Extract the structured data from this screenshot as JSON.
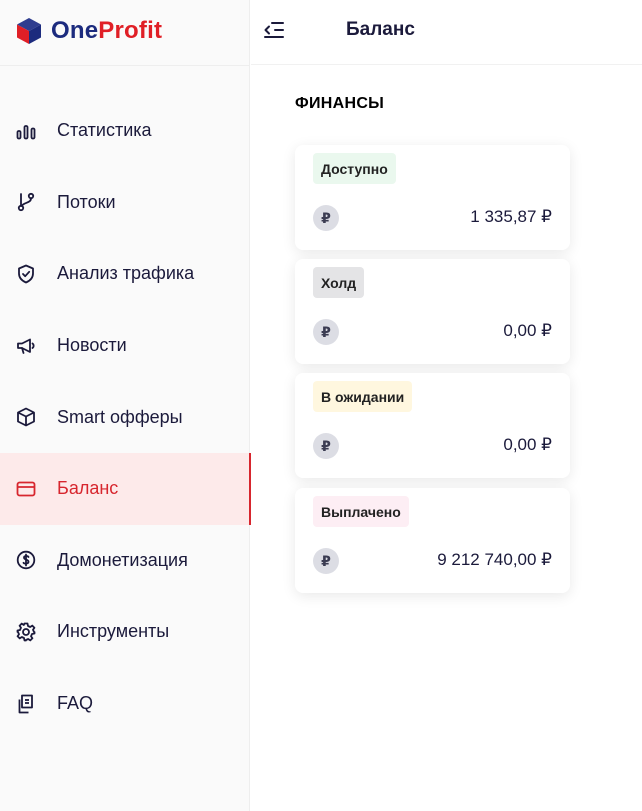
{
  "brand": {
    "part1": "One",
    "part2": "Profit",
    "colors": {
      "primary": "#1c2b7e",
      "accent": "#e01f26"
    }
  },
  "header": {
    "title": "Баланс",
    "collapse_icon": "collapse-sidebar-icon"
  },
  "sidebar": {
    "items": [
      {
        "label": "Статистика",
        "icon": "bar-chart-icon"
      },
      {
        "label": "Потоки",
        "icon": "git-branch-icon"
      },
      {
        "label": "Анализ трафика",
        "icon": "shield-check-icon"
      },
      {
        "label": "Новости",
        "icon": "megaphone-icon"
      },
      {
        "label": "Smart офферы",
        "icon": "cube-icon"
      },
      {
        "label": "Баланс",
        "icon": "card-icon",
        "active": true
      },
      {
        "label": "Домонетизация",
        "icon": "dollar-icon"
      },
      {
        "label": "Инструменты",
        "icon": "gear-icon"
      },
      {
        "label": "FAQ",
        "icon": "document-icon"
      }
    ],
    "active_color": "#d7262e"
  },
  "main": {
    "section_title": "ФИНАНСЫ",
    "cards": [
      {
        "label": "Доступно",
        "amount": "1 335,87 ₽",
        "badge_color": "#eaf8ee",
        "currency_symbol": "₽"
      },
      {
        "label": "Холд",
        "amount": "0,00 ₽",
        "badge_color": "#e4e4e6",
        "currency_symbol": "₽"
      },
      {
        "label": "В ожидании",
        "amount": "0,00 ₽",
        "badge_color": "#fff7df",
        "currency_symbol": "₽"
      },
      {
        "label": "Выплачено",
        "amount": "9 212 740,00 ₽",
        "badge_color": "#fdeef4",
        "currency_symbol": "₽"
      }
    ]
  }
}
